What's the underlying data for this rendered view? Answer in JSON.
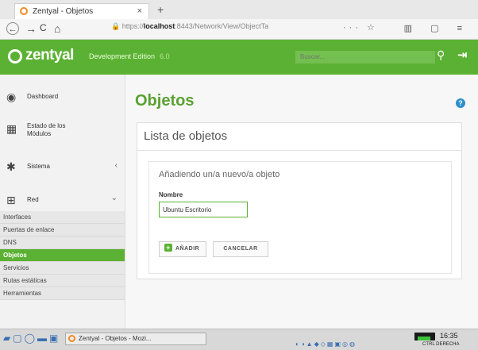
{
  "browser": {
    "tab_title": "Zentyal - Objetos",
    "tab_close": "×",
    "new_tab": "+",
    "back": "←",
    "forward": "→",
    "reload": "C",
    "home": "⌂",
    "url_host": "localhost",
    "url_prefix": "https://",
    "url_rest": ":8443/Network/View/ObjectTa",
    "url_more": "···",
    "right_tools": "▥ ▢ ≡"
  },
  "header": {
    "brand": "zentyal",
    "edition": "Development Edition",
    "version": "6.0",
    "search_placeholder": "Buscar...",
    "accent": "#5bb133"
  },
  "sidebar": {
    "items": [
      {
        "label": "Dashboard",
        "icon": "dashboard-icon",
        "chevron": ""
      },
      {
        "label": "Estado de los Módulos",
        "icon": "modules-icon",
        "chevron": ""
      },
      {
        "label": "Sistema",
        "icon": "gear-icon",
        "chevron": "‹"
      },
      {
        "label": "Red",
        "icon": "network-icon",
        "chevron": "⌄"
      }
    ],
    "subitems": [
      {
        "label": "Interfaces",
        "active": false
      },
      {
        "label": "Puertas de enlace",
        "active": false
      },
      {
        "label": "DNS",
        "active": false
      },
      {
        "label": "Objetos",
        "active": true
      },
      {
        "label": "Servicios",
        "active": false
      },
      {
        "label": "Rutas estáticas",
        "active": false
      },
      {
        "label": "Herramientas",
        "active": false
      }
    ]
  },
  "main": {
    "page_title": "Objetos",
    "help": "?",
    "card_title": "Lista de objetos",
    "form_heading": "Añadiendo un/a nuevo/a objeto",
    "field_label": "Nombre",
    "field_value": "Ubuntu Escritorio",
    "add_button": "AÑADIR",
    "cancel_button": "CANCELAR"
  },
  "taskbar": {
    "window_title": "Zentyal - Objetos - Mozi...",
    "clock": "16:35",
    "host": "CTRL DERECHA"
  }
}
